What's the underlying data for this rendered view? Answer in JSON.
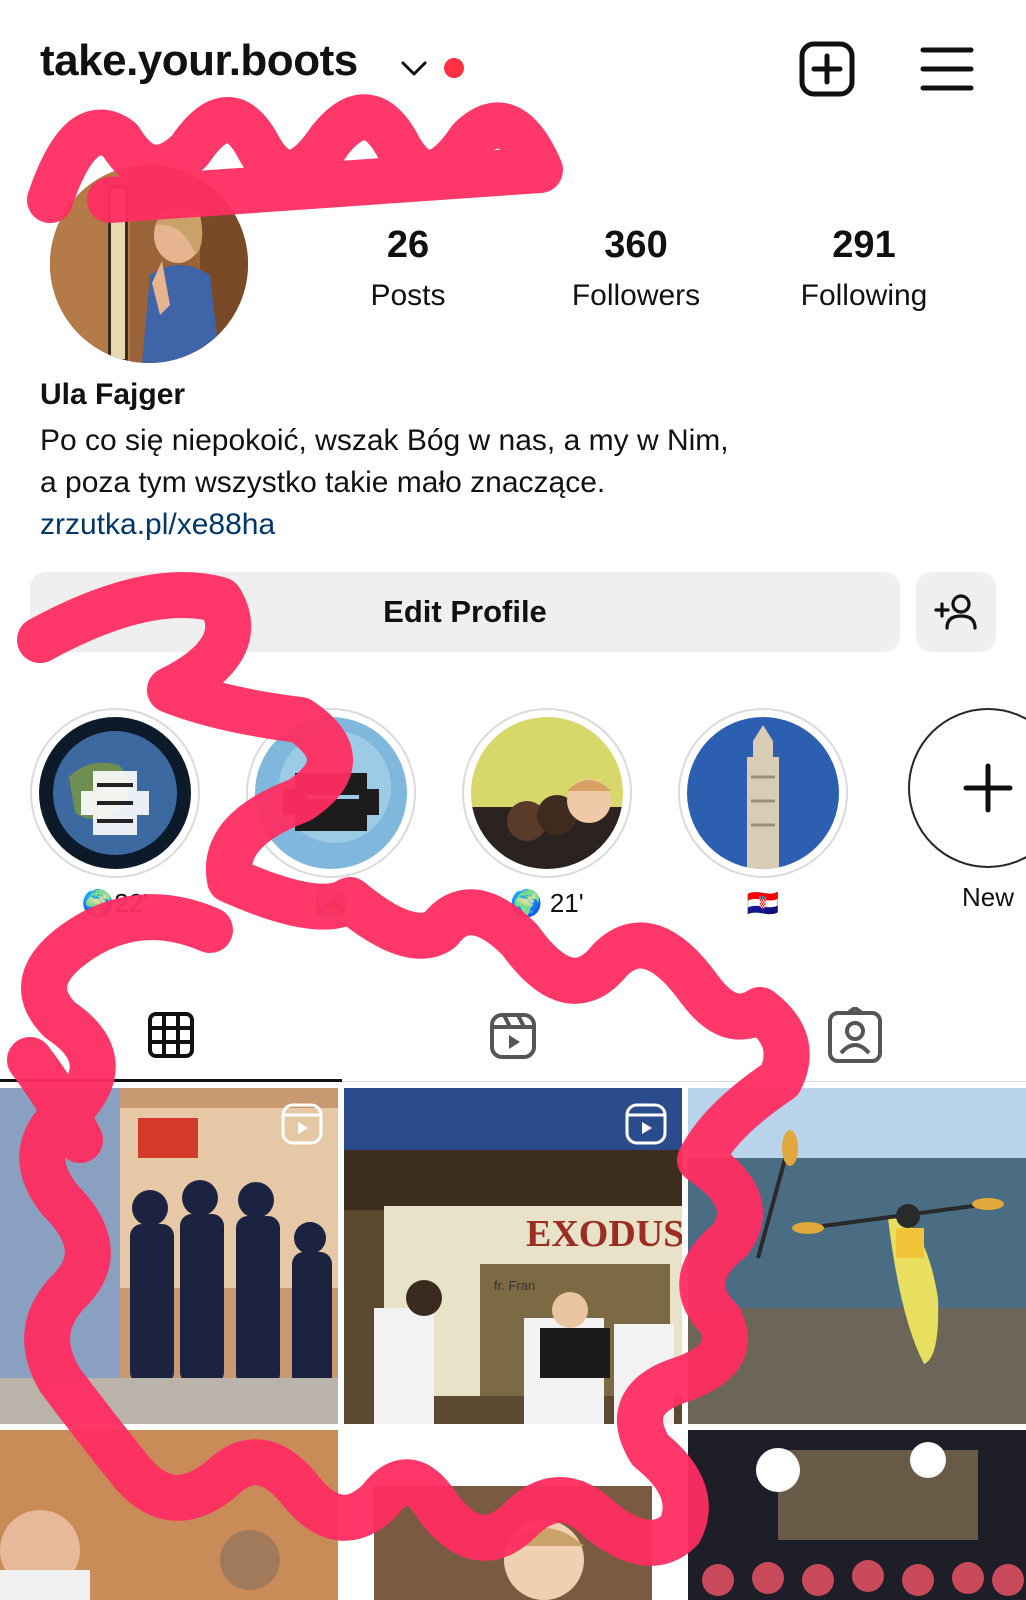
{
  "header": {
    "username": "take.your.boots",
    "icons": {
      "dropdown": "chevron-down-icon",
      "notification": "red-dot",
      "new_post": "plus-square-icon",
      "menu": "hamburger-menu-icon"
    }
  },
  "profile": {
    "stats": [
      {
        "value": "26",
        "label": "Posts"
      },
      {
        "value": "360",
        "label": "Followers"
      },
      {
        "value": "291",
        "label": "Following"
      }
    ],
    "name": "Ula Fajger",
    "bio_lines": [
      "Po co się niepokoić, wszak Bóg w nas, a my w Nim,",
      "a poza tym wszystko takie mało znaczące."
    ],
    "link": "zrzutka.pl/xe88ha"
  },
  "actions": {
    "edit_profile": "Edit Profile",
    "add_user_icon": "person-plus-icon"
  },
  "highlights": [
    {
      "label": "🌍22'"
    },
    {
      "label": "🏞️"
    },
    {
      "label": "🌍 21'"
    },
    {
      "label": "🇭🇷"
    },
    {
      "label": "New"
    }
  ],
  "tabs": [
    {
      "icon": "grid-icon",
      "active": true
    },
    {
      "icon": "reels-icon",
      "active": false
    },
    {
      "icon": "tagged-icon",
      "active": false
    }
  ],
  "grid_overlays": {
    "exodus_banner": "EXODUS",
    "photo_caption": "fr. Fran"
  },
  "colors": {
    "accent_red": "#ff3040",
    "scribble": "#ff2d61",
    "link": "#00376b",
    "button_bg": "#efefef"
  }
}
